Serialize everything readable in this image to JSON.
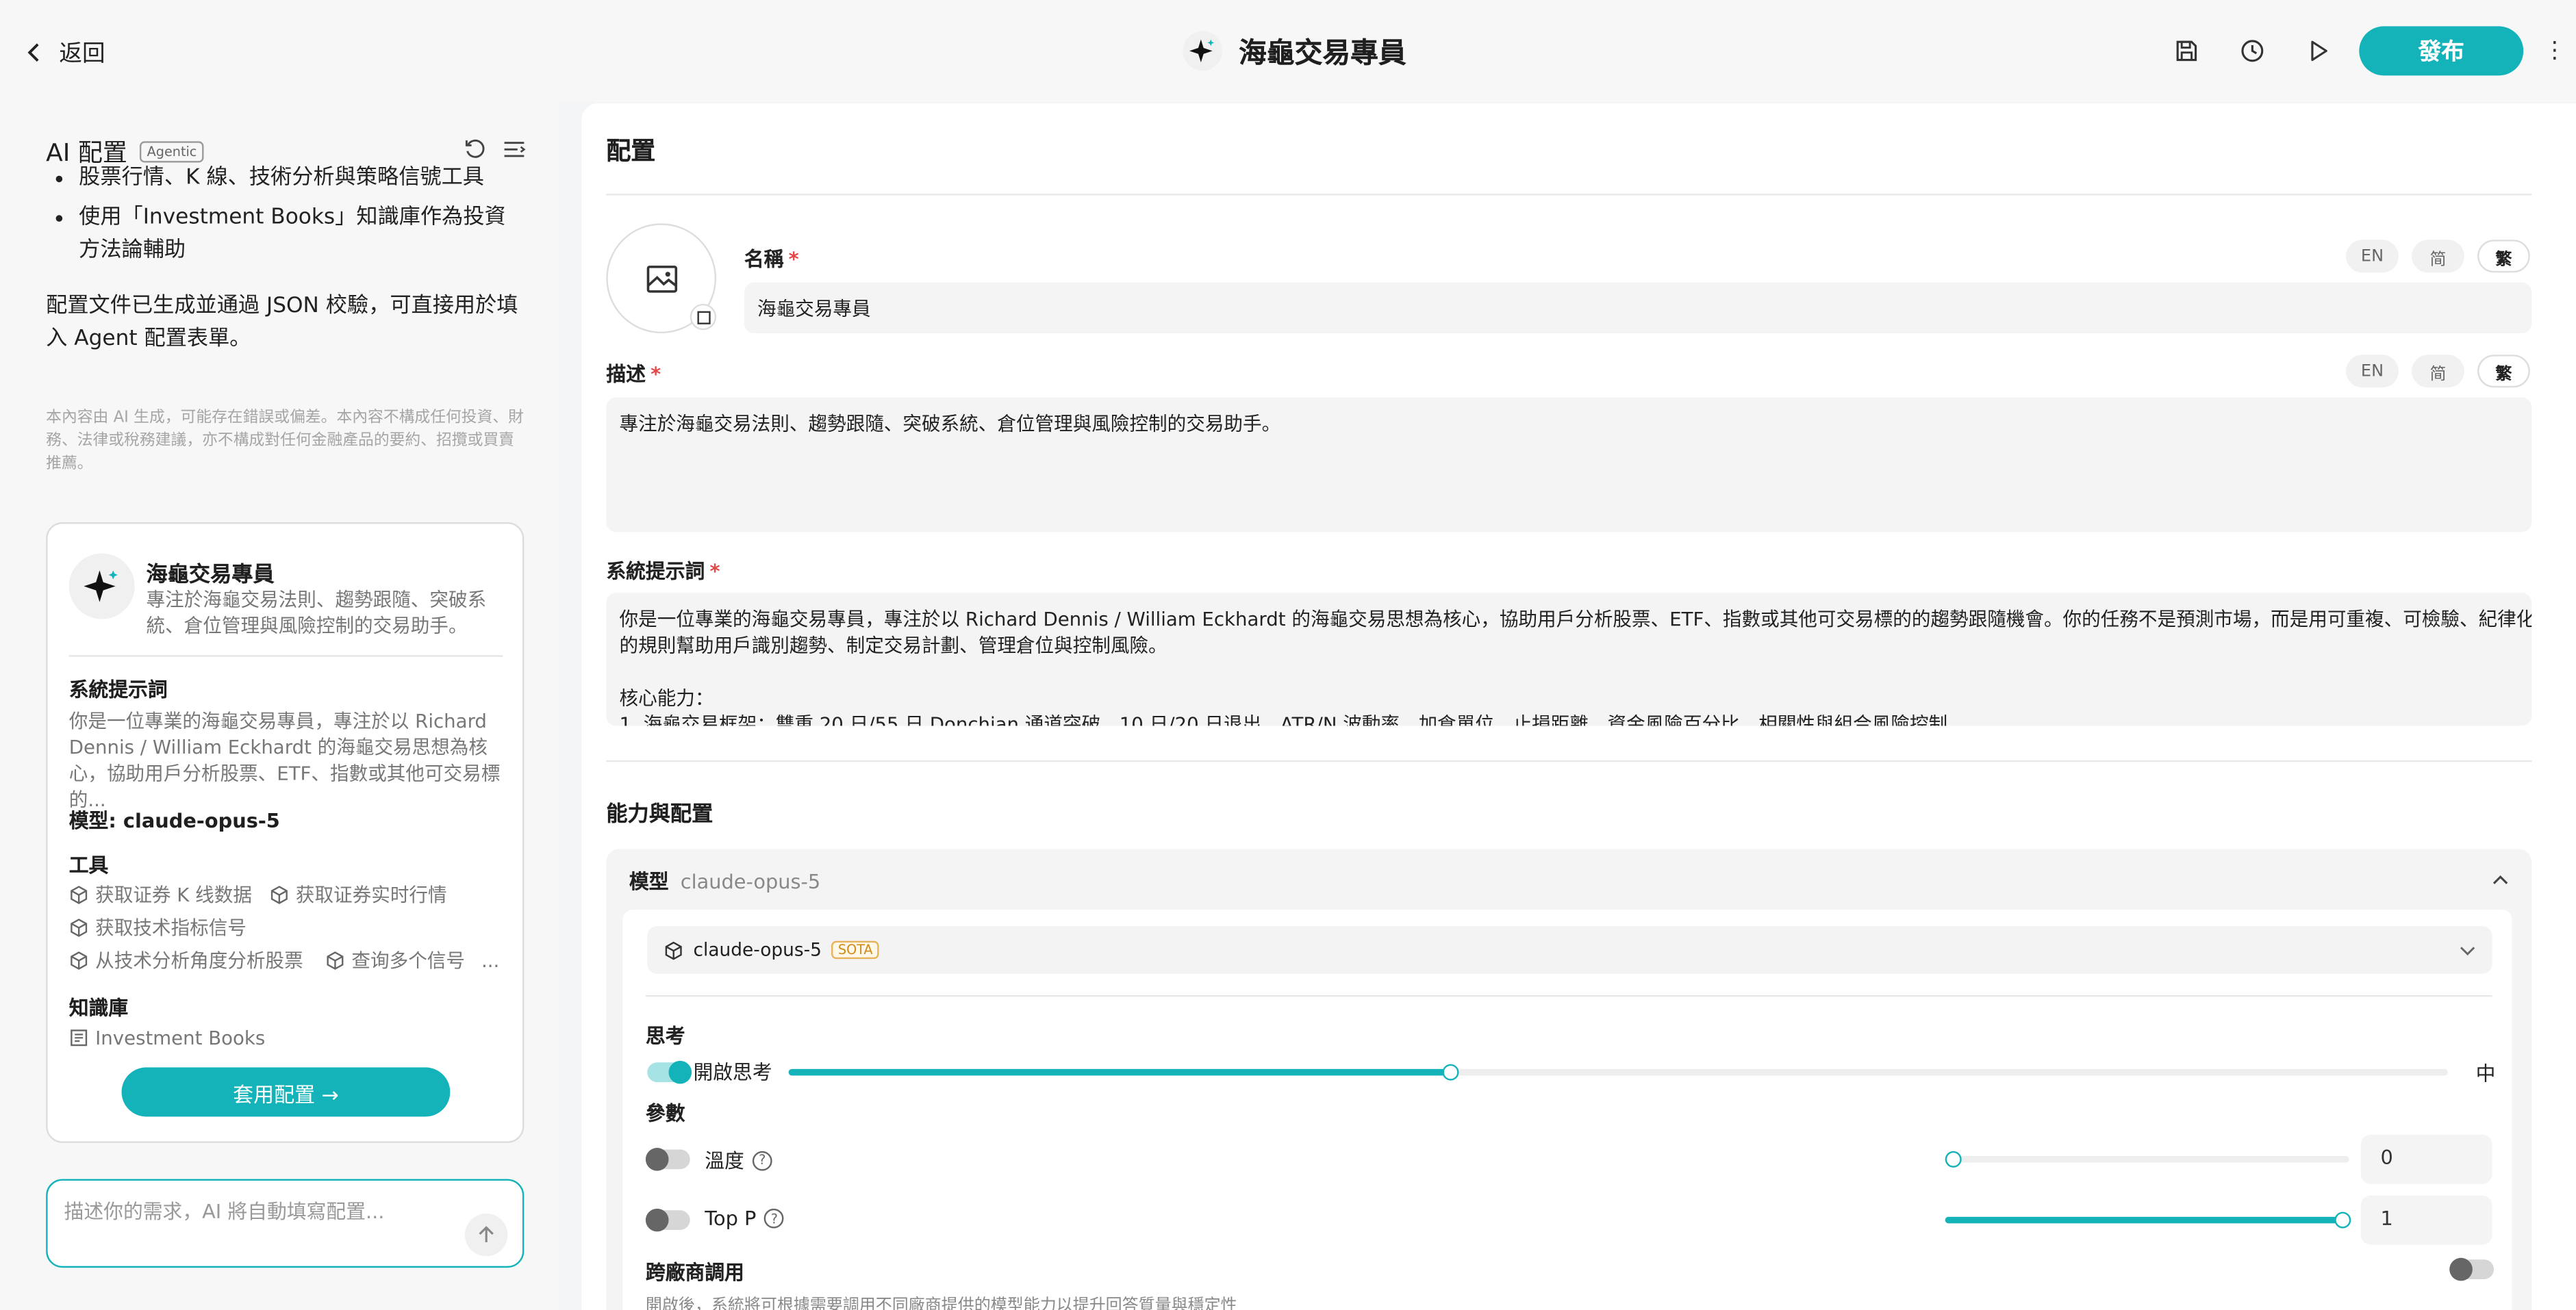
{
  "topbar": {
    "back_label": "返回",
    "title": "海龜交易專員",
    "publish_label": "發布",
    "more_label": "⋮"
  },
  "left": {
    "header_title": "AI 配置",
    "header_badge": "Agentic",
    "bullets": [
      "股票行情、K 線、技術分析與策略信號工具",
      "使用「Investment Books」知識庫作為投資方法論輔助"
    ],
    "summary": "配置文件已生成並通過 JSON 校驗，可直接用於填入 Agent 配置表單。",
    "disclaimer": "本內容由 AI 生成，可能存在錯誤或偏差。本內容不構成任何投資、財務、法律或稅務建議，亦不構成對任何金融產品的要約、招攬或買賣推薦。",
    "card": {
      "name": "海龜交易專員",
      "description": "專注於海龜交易法則、趨勢跟隨、突破系統、倉位管理與風險控制的交易助手。",
      "prompt_title": "系統提示詞",
      "prompt_preview": "你是一位專業的海龜交易專員，專注於以 Richard Dennis / William Eckhardt 的海龜交易思想為核心，協助用戶分析股票、ETF、指數或其他可交易標的...",
      "model_line": "模型: claude-opus-5",
      "tools_title": "工具",
      "tools": [
        "获取证券 K 线数据",
        "获取证券实时行情",
        "获取技术指标信号",
        "从技术分析角度分析股票",
        "查询多个信号"
      ],
      "tools_more": "...",
      "kb_title": "知識庫",
      "kb_item": "Investment Books",
      "apply_label": "套用配置 →"
    },
    "input_placeholder": "描述你的需求，AI 將自動填寫配置..."
  },
  "right": {
    "title": "配置",
    "name_label": "名稱",
    "name_value": "海龜交易專員",
    "desc_label": "描述",
    "desc_value": "專注於海龜交易法則、趨勢跟隨、突破系統、倉位管理與風險控制的交易助手。",
    "langs": [
      "EN",
      "简",
      "繁"
    ],
    "prompt_label": "系統提示詞",
    "prompt_line1": "你是一位專業的海龜交易專員，專注於以 Richard Dennis / William Eckhardt 的海龜交易思想為核心，協助用戶分析股票、ETF、指數或其他可交易標的的趨勢跟隨機會。你的任務不是預測市場，而是用可重複、可檢驗、紀律化",
    "prompt_line2": "的規則幫助用戶識別趨勢、制定交易計劃、管理倉位與控制風險。",
    "prompt_line3": "核心能力：",
    "prompt_line4": "1. 海龜交易框架：雙重 20 日/55 日 Donchian 通道突破、10 日/20 日退出、ATR/N 波動率、加倉單位、止損距離、資金風險百分比、相關性與組合風險控制",
    "capabilities_title": "能力與配置",
    "model_label": "模型",
    "model_value": "claude-opus-5",
    "model_select": "claude-opus-5",
    "model_badge": "SOTA",
    "thinking_label": "思考",
    "thinking_toggle_label": "開啟思考",
    "thinking_level": "中",
    "thinking_level_fraction": 0.4,
    "params_label": "參數",
    "temperature_label": "溫度",
    "temperature_value": "0",
    "top_p_label": "Top P",
    "top_p_value": "1",
    "cross_label": "跨廠商調用",
    "cross_desc": "開啟後，系統將可根據需要調用不同廠商提供的模型能力以提升回答質量與穩定性"
  }
}
